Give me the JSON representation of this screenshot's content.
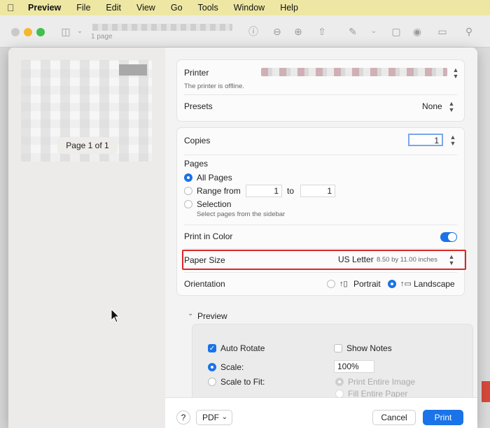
{
  "menubar": {
    "app_name": "Preview",
    "items": [
      "File",
      "Edit",
      "View",
      "Go",
      "Tools",
      "Window",
      "Help"
    ]
  },
  "toolbar": {
    "page_count": "1 page"
  },
  "preview": {
    "page_badge": "Page 1 of 1"
  },
  "printer": {
    "label": "Printer",
    "status": "The printer is offline."
  },
  "presets": {
    "label": "Presets",
    "value": "None"
  },
  "copies": {
    "label": "Copies",
    "value": "1"
  },
  "pages": {
    "label": "Pages",
    "all_pages": "All Pages",
    "range_from": "Range from",
    "range_start": "1",
    "to": "to",
    "range_end": "1",
    "selection": "Selection",
    "selection_hint": "Select pages from the sidebar"
  },
  "color": {
    "label": "Print in Color"
  },
  "paper": {
    "label": "Paper Size",
    "value": "US Letter",
    "dims": "8.50 by 11.00 inches"
  },
  "orientation": {
    "label": "Orientation",
    "portrait": "Portrait",
    "landscape": "Landscape"
  },
  "preview_section": {
    "label": "Preview",
    "auto_rotate": "Auto Rotate",
    "show_notes": "Show Notes",
    "scale": "Scale:",
    "scale_value": "100%",
    "scale_to_fit": "Scale to Fit:",
    "print_entire_image": "Print Entire Image",
    "fill_entire_paper": "Fill Entire Paper"
  },
  "footer": {
    "help": "?",
    "pdf": "PDF",
    "cancel": "Cancel",
    "print": "Print"
  },
  "colors": {
    "accent": "#1a73e8",
    "highlight": "#e02424",
    "menubar": "#eee7a4"
  }
}
